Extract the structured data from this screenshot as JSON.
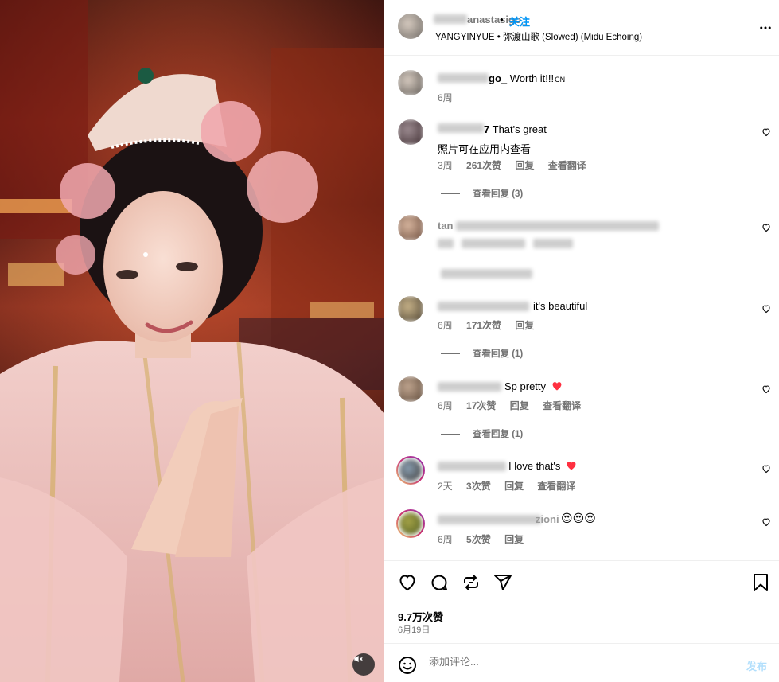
{
  "header": {
    "username": "anastasigo_",
    "separator": "•",
    "follow_label": "关注",
    "music": "YANGYINYUE • 弥渡山歌 (Slowed) (Midu Echoing)"
  },
  "caption": {
    "username_suffix": "go_",
    "text": "Worth it!!!",
    "badge": "CN",
    "time": "6周"
  },
  "comments": [
    {
      "username_suffix": "7",
      "text": "That's great",
      "extra_line": "照片可在应用内查看",
      "time": "3周",
      "likes": "261次赞",
      "reply_label": "回复",
      "translate_label": "查看翻译",
      "view_replies": "查看回复 (3)",
      "has_heart": false
    },
    {
      "username_suffix": "tan",
      "text": "",
      "time": "",
      "likes": "",
      "reply_label": "",
      "translate_label": "",
      "view_replies": "",
      "has_heart": false
    },
    {
      "username_suffix": "y_galena_iamm",
      "text": "it's beautiful",
      "time": "6周",
      "likes": "171次赞",
      "reply_label": "回复",
      "translate_label": "",
      "view_replies": "查看回复 (1)",
      "has_heart": false
    },
    {
      "username_suffix": "n_dtrii",
      "text": "Sp pretty",
      "time": "6周",
      "likes": "17次赞",
      "reply_label": "回复",
      "translate_label": "查看翻译",
      "view_replies": "查看回复 (1)",
      "has_heart": true
    },
    {
      "username_suffix": "",
      "text": "I love that's",
      "time": "2天",
      "likes": "3次赞",
      "reply_label": "回复",
      "translate_label": "查看翻译",
      "view_replies": "",
      "has_heart": true
    },
    {
      "username_suffix": "zioni",
      "text": "😍😍😍",
      "time": "6周",
      "likes": "5次赞",
      "reply_label": "回复",
      "translate_label": "",
      "view_replies": "",
      "has_heart": false
    }
  ],
  "actions": {
    "likes": "9.7万次赞",
    "date": "6月19日"
  },
  "composer": {
    "placeholder": "添加评论...",
    "post_label": "发布"
  },
  "colors": {
    "link_blue": "#0095f6",
    "post_disabled": "#b2dffc",
    "heart_red": "#ff3040",
    "secondary_text": "#737373"
  },
  "icons": [
    "more-icon",
    "heart-icon",
    "comment-icon",
    "repost-icon",
    "share-icon",
    "save-icon",
    "emoji-icon",
    "mute-icon"
  ]
}
